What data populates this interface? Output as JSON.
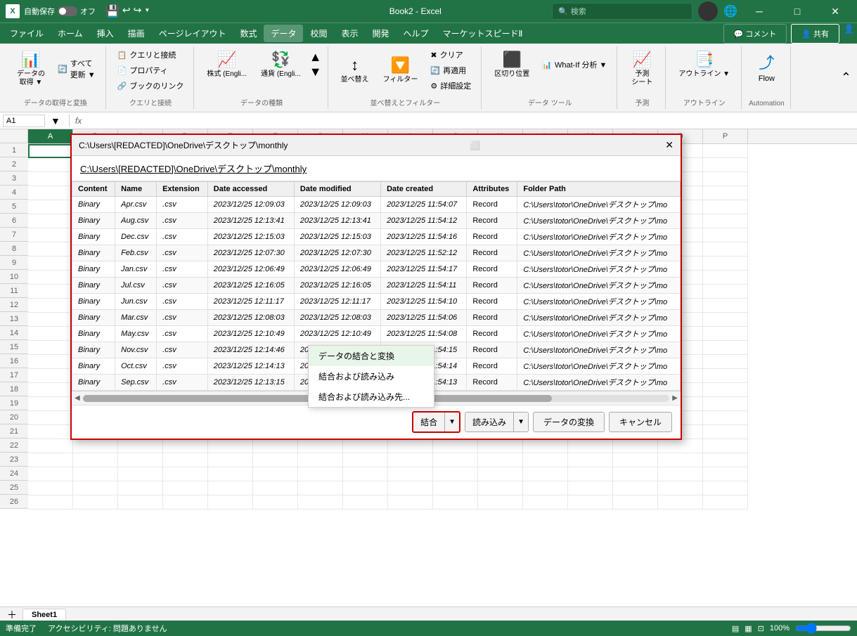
{
  "titleBar": {
    "appIcon": "X",
    "autosaveLabel": "自動保存",
    "toggleState": "off",
    "undoLabel": "↩",
    "redoLabel": "↪",
    "fileName": "Book2 - Excel",
    "searchPlaceholder": "検索",
    "userLabel": "User",
    "minimizeIcon": "─",
    "maximizeIcon": "□",
    "closeIcon": "✕"
  },
  "menuBar": {
    "items": [
      "ファイル",
      "ホーム",
      "挿入",
      "描画",
      "ページレイアウト",
      "数式",
      "データ",
      "校閲",
      "表示",
      "開発",
      "ヘルプ",
      "マーケットスピードⅡ"
    ]
  },
  "ribbon": {
    "groups": [
      {
        "label": "データの取得と変換",
        "buttons": [
          "データの取得▼",
          "すべて更新▼",
          "クエリと接続",
          "プロパティ",
          "ブックのリンク"
        ]
      },
      {
        "label": "クエリと接続",
        "buttons": []
      },
      {
        "label": "データの種類",
        "buttons": [
          "株式 (Engli...",
          "通貨 (Engli..."
        ]
      },
      {
        "label": "並べ替えとフィルター",
        "buttons": [
          "並べ替え",
          "フィルター",
          "クリア",
          "再適用",
          "詳細設定"
        ]
      },
      {
        "label": "データ ツール",
        "buttons": [
          "区切り位置",
          "What-If 分析▼"
        ]
      },
      {
        "label": "予測",
        "buttons": [
          "予測シート"
        ]
      },
      {
        "label": "アウトライン",
        "buttons": [
          "アウトライン▼"
        ]
      },
      {
        "label": "Automation",
        "buttons": [
          "Flow"
        ]
      }
    ],
    "commentLabel": "コメント",
    "shareLabel": "共有"
  },
  "formulaBar": {
    "cellRef": "A1",
    "formula": ""
  },
  "dialog": {
    "title": "C:\\Users\\[REDACTED]\\OneDrive\\デスクトップ\\monthly",
    "pathDisplay": "C:\\Users\\[REDACTED]\\OneDrive\\デスクトップ\\monthly",
    "tableHeaders": [
      "Content",
      "Name",
      "Extension",
      "Date accessed",
      "Date modified",
      "Date created",
      "Attributes",
      "Folder Path"
    ],
    "rows": [
      {
        "content": "Binary",
        "name": "Apr.csv",
        "ext": ".csv",
        "accessed": "2023/12/25 12:09:03",
        "modified": "2023/12/25 12:09:03",
        "created": "2023/12/25 11:54:07",
        "attr": "Record",
        "path": "C:\\Users\\totor\\OneDrive\\デスクトップ\\mo"
      },
      {
        "content": "Binary",
        "name": "Aug.csv",
        "ext": ".csv",
        "accessed": "2023/12/25 12:13:41",
        "modified": "2023/12/25 12:13:41",
        "created": "2023/12/25 11:54:12",
        "attr": "Record",
        "path": "C:\\Users\\totor\\OneDrive\\デスクトップ\\mo"
      },
      {
        "content": "Binary",
        "name": "Dec.csv",
        "ext": ".csv",
        "accessed": "2023/12/25 12:15:03",
        "modified": "2023/12/25 12:15:03",
        "created": "2023/12/25 11:54:16",
        "attr": "Record",
        "path": "C:\\Users\\totor\\OneDrive\\デスクトップ\\mo"
      },
      {
        "content": "Binary",
        "name": "Feb.csv",
        "ext": ".csv",
        "accessed": "2023/12/25 12:07:30",
        "modified": "2023/12/25 12:07:30",
        "created": "2023/12/25 11:52:12",
        "attr": "Record",
        "path": "C:\\Users\\totor\\OneDrive\\デスクトップ\\mo"
      },
      {
        "content": "Binary",
        "name": "Jan.csv",
        "ext": ".csv",
        "accessed": "2023/12/25 12:06:49",
        "modified": "2023/12/25 12:06:49",
        "created": "2023/12/25 11:54:17",
        "attr": "Record",
        "path": "C:\\Users\\totor\\OneDrive\\デスクトップ\\mo"
      },
      {
        "content": "Binary",
        "name": "Jul.csv",
        "ext": ".csv",
        "accessed": "2023/12/25 12:16:05",
        "modified": "2023/12/25 12:16:05",
        "created": "2023/12/25 11:54:11",
        "attr": "Record",
        "path": "C:\\Users\\totor\\OneDrive\\デスクトップ\\mo"
      },
      {
        "content": "Binary",
        "name": "Jun.csv",
        "ext": ".csv",
        "accessed": "2023/12/25 12:11:17",
        "modified": "2023/12/25 12:11:17",
        "created": "2023/12/25 11:54:10",
        "attr": "Record",
        "path": "C:\\Users\\totor\\OneDrive\\デスクトップ\\mo"
      },
      {
        "content": "Binary",
        "name": "Mar.csv",
        "ext": ".csv",
        "accessed": "2023/12/25 12:08:03",
        "modified": "2023/12/25 12:08:03",
        "created": "2023/12/25 11:54:06",
        "attr": "Record",
        "path": "C:\\Users\\totor\\OneDrive\\デスクトップ\\mo"
      },
      {
        "content": "Binary",
        "name": "May.csv",
        "ext": ".csv",
        "accessed": "2023/12/25 12:10:49",
        "modified": "2023/12/25 12:10:49",
        "created": "2023/12/25 11:54:08",
        "attr": "Record",
        "path": "C:\\Users\\totor\\OneDrive\\デスクトップ\\mo"
      },
      {
        "content": "Binary",
        "name": "Nov.csv",
        "ext": ".csv",
        "accessed": "2023/12/25 12:14:46",
        "modified": "2023/12/25 12:14:46",
        "created": "2023/12/25 11:54:15",
        "attr": "Record",
        "path": "C:\\Users\\totor\\OneDrive\\デスクトップ\\mo"
      },
      {
        "content": "Binary",
        "name": "Oct.csv",
        "ext": ".csv",
        "accessed": "2023/12/25 12:14:13",
        "modified": "2023/12/25 12:14:13",
        "created": "2023/12/25 11:54:14",
        "attr": "Record",
        "path": "C:\\Users\\totor\\OneDrive\\デスクトップ\\mo"
      },
      {
        "content": "Binary",
        "name": "Sep.csv",
        "ext": ".csv",
        "accessed": "2023/12/25 12:13:15",
        "modified": "2023/12/25 12:13:15",
        "created": "2023/12/25 11:54:13",
        "attr": "Record",
        "path": "C:\\Users\\totor\\OneDrive\\デスクトップ\\mo"
      }
    ],
    "footerButtons": {
      "combineLabel": "結合",
      "loadLabel": "読み込み",
      "transformLabel": "データの変換",
      "cancelLabel": "キャンセル"
    },
    "dropdownMenu": {
      "items": [
        "データの結合と変換",
        "結合および読み込み",
        "結合および読み込み先..."
      ]
    },
    "closeIcon": "✕"
  },
  "sheetTabs": [
    "Sheet1"
  ],
  "statusBar": {
    "readyLabel": "準備完了",
    "accessibilityLabel": "アクセシビリティ: 問題ありません"
  },
  "columns": [
    "A",
    "B",
    "C",
    "D",
    "E",
    "F",
    "G",
    "H",
    "I",
    "J",
    "K",
    "L",
    "M",
    "N",
    "O",
    "P"
  ],
  "rows": [
    1,
    2,
    3,
    4,
    5,
    6,
    7,
    8,
    9,
    10,
    11,
    12,
    13,
    14,
    15,
    16,
    17,
    18,
    19,
    20,
    21,
    22,
    23,
    24,
    25,
    26
  ]
}
